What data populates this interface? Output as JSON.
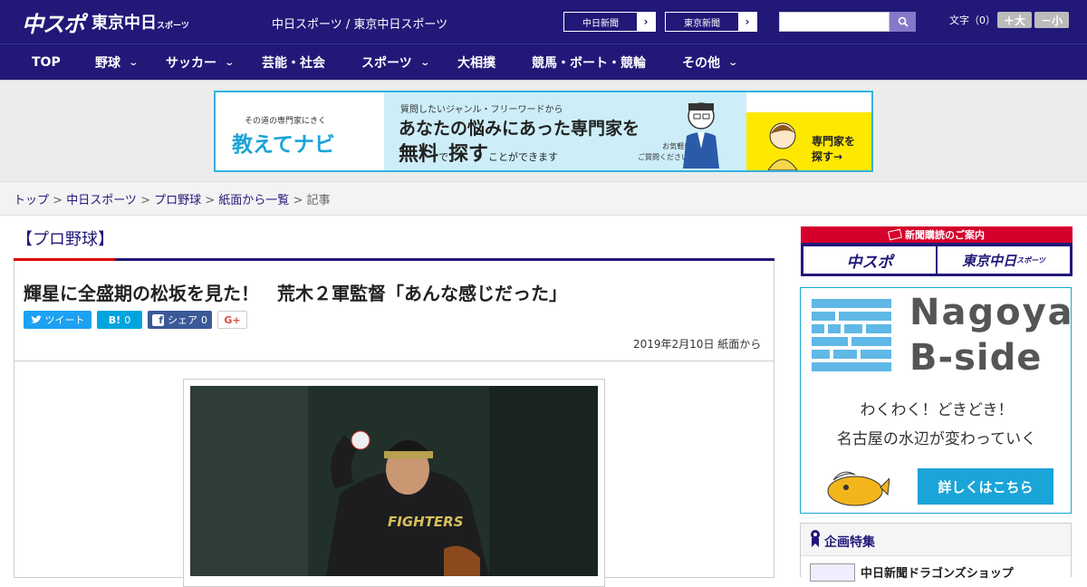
{
  "header": {
    "logo_main": "中スポ",
    "logo_tokyo": "東京中日",
    "logo_tokyo_sub": "スポーツ",
    "site_links": "中日スポーツ / 東京中日スポーツ",
    "paper_buttons": [
      "中日新聞",
      "東京新聞"
    ],
    "search_placeholder": "",
    "font_size_label": "文字（0）",
    "font_larger": "＋大",
    "font_smaller": "－小"
  },
  "nav": {
    "items": [
      {
        "label": "TOP",
        "dropdown": false
      },
      {
        "label": "野球",
        "dropdown": true
      },
      {
        "label": "サッカー",
        "dropdown": true
      },
      {
        "label": "芸能・社会",
        "dropdown": false
      },
      {
        "label": "スポーツ",
        "dropdown": true
      },
      {
        "label": "大相撲",
        "dropdown": false
      },
      {
        "label": "競馬・ボート・競輪",
        "dropdown": false
      },
      {
        "label": "その他",
        "dropdown": true
      }
    ]
  },
  "banner": {
    "tagline": "その道の専門家にきく",
    "brand": "教えてナビ",
    "line1": "質問したいジャンル・フリーワードから",
    "line2": "あなたの悩みにあった専門家を",
    "line3a": "無料",
    "line3b": "で",
    "line3c": "探す",
    "line3d": "ことができます",
    "note1": "お気軽に",
    "note2": "ご質問ください!",
    "cta1": "専門家を",
    "cta2": "探す→"
  },
  "breadcrumbs": {
    "items": [
      "トップ",
      "中日スポーツ",
      "プロ野球",
      "紙面から一覧"
    ],
    "current": "記事",
    "sep": " > "
  },
  "article": {
    "category": "【プロ野球】",
    "headline": "輝星に全盛期の松坂を見た！　荒木２軍監督「あんな感じだった」",
    "date": "2019年2月10日 紙面から",
    "share": {
      "tweet": "ツイート",
      "hatena": "B!",
      "hatena_count": "0",
      "facebook": "シェア",
      "facebook_count": "0",
      "gplus": "G+"
    },
    "photo_jersey": "FIGHTERS"
  },
  "sidebar": {
    "subscribe_header": "新聞購読のご案内",
    "subscribe_a": "中スポ",
    "subscribe_b": "東京中日",
    "subscribe_b_sub": "スポーツ",
    "ad_title1": "Nagoya",
    "ad_title2": "B-side",
    "ad_copy1": "わくわく！どきどき！",
    "ad_copy2": "名古屋の水辺が変わっていく",
    "ad_cta": "詳しくはこちら",
    "feature_header": "企画特集",
    "feature_item": "中日新聞ドラゴンズショップ"
  },
  "colors": {
    "navy": "#221878",
    "red": "#d5002b",
    "cyan": "#1aa4d8",
    "twitter": "#1da1f2",
    "hatena": "#00a4de",
    "facebook": "#3b5998",
    "gplus": "#dd4b39"
  }
}
